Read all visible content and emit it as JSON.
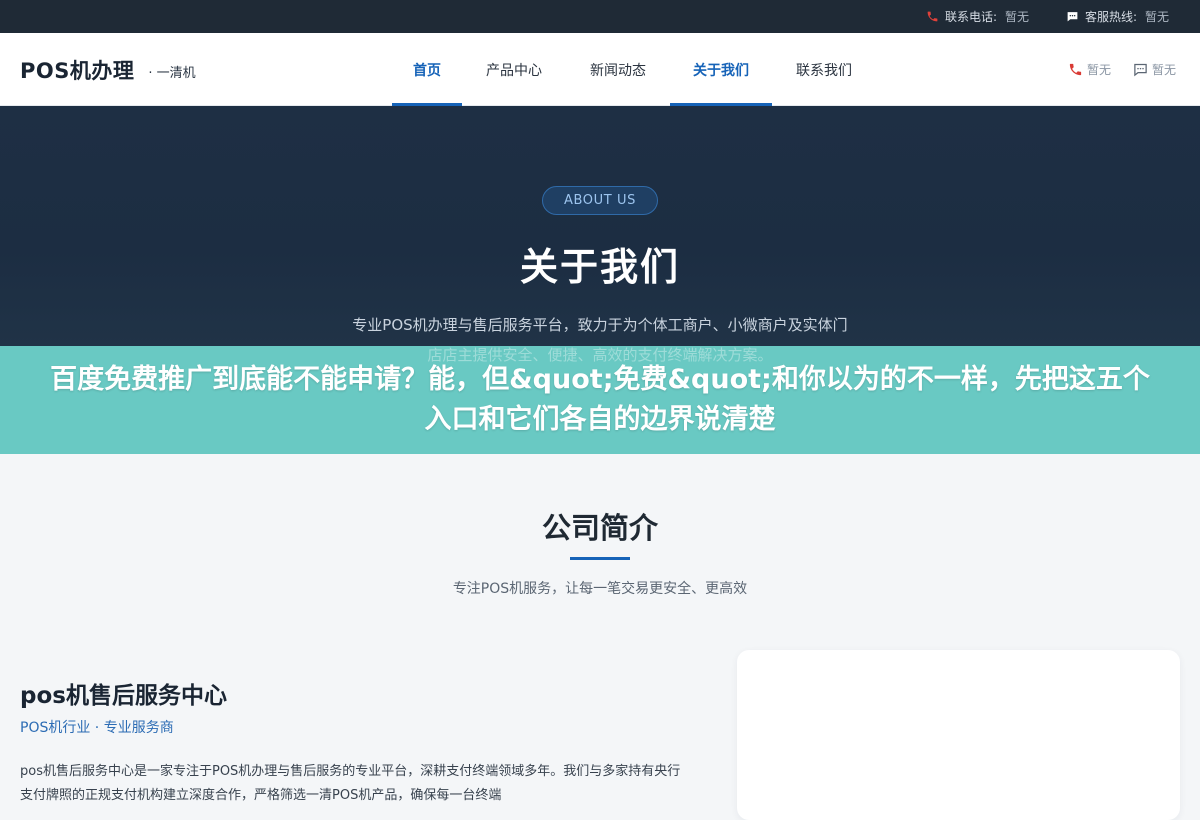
{
  "topbar": {
    "phone_label": "联系电话:",
    "phone_value": "暂无",
    "service_label": "客服热线:",
    "service_value": "暂无"
  },
  "header": {
    "brand": "POS机办理",
    "sub": "· 一清机",
    "nav": [
      {
        "label": "首页",
        "active": true
      },
      {
        "label": "产品中心",
        "active": false
      },
      {
        "label": "新闻动态",
        "active": false
      },
      {
        "label": "关于我们",
        "active": true
      },
      {
        "label": "联系我们",
        "active": false
      }
    ],
    "right_phone": "暂无",
    "right_chat": "暂无"
  },
  "hero": {
    "pill": "ABOUT US",
    "title": "关于我们",
    "desc_line1": "专业POS机办理与售后服务平台，致力于为个体工商户、小微商户及实体门",
    "desc_line2": "店店主提供安全、便捷、高效的支付终端解决方案。"
  },
  "banner": {
    "headline": "百度免费推广到底能不能申请？能，但&quot;免费&quot;和你以为的不一样，先把这五个入口和它们各自的边界说清楚"
  },
  "intro": {
    "title": "公司简介",
    "subtitle": "专注POS机服务，让每一笔交易更安全、更高效"
  },
  "company": {
    "name": "pos机售后服务中心",
    "meta": "POS机行业 · 专业服务商",
    "desc": "pos机售后服务中心是一家专注于POS机办理与售后服务的专业平台，深耕支付终端领域多年。我们与多家持有央行支付牌照的正规支付机构建立深度合作，严格筛选一清POS机产品，确保每一台终端"
  },
  "colors": {
    "accent": "#1663b8",
    "topbar": "#1f2a36",
    "hero": "#1e2f44",
    "banner": "#69c9c3"
  }
}
